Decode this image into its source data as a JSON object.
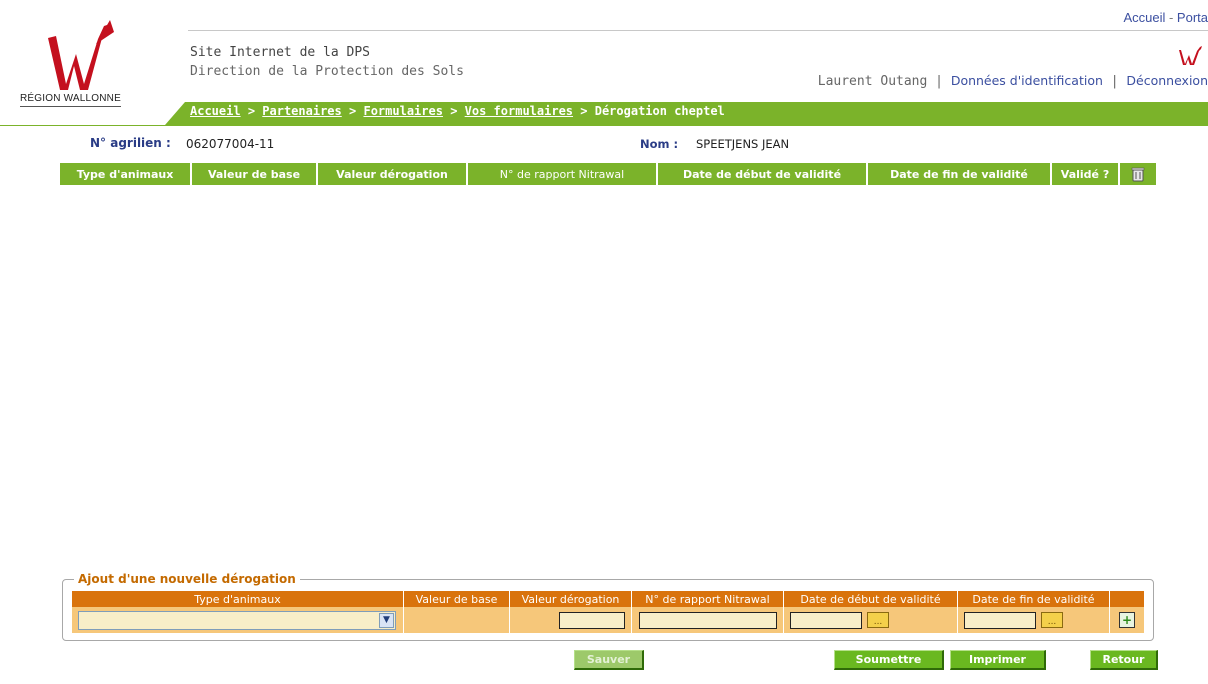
{
  "header": {
    "region_label": "RÉGION WALLONNE",
    "site_title": "Site Internet de la DPS",
    "site_subtitle": "Direction de la Protection des Sols",
    "top_links": {
      "home": "Accueil",
      "separator": " - ",
      "portal": "Porta"
    },
    "user_name": "Laurent Outang",
    "user_links": {
      "identification": "Données d'identification",
      "logout": "Déconnexion"
    },
    "brand_color": "#7bb32a",
    "accent_color": "#d9730c"
  },
  "breadcrumb": {
    "items": [
      "Accueil",
      "Partenaires",
      "Formulaires",
      "Vos formulaires"
    ],
    "separator": ">",
    "current": "Dérogation cheptel"
  },
  "info": {
    "agrilien_label": "N° agrilien :",
    "agrilien_value": "062077004-11",
    "nom_label": "Nom :",
    "nom_value": "SPEETJENS JEAN"
  },
  "main_table": {
    "columns": [
      "Type d'animaux",
      "Valeur de base",
      "Valeur dérogation",
      "N° de rapport Nitrawal",
      "Date de début de validité",
      "Date de fin de validité",
      "Validé ?"
    ],
    "trash_icon": "trash-icon",
    "rows": []
  },
  "add_form": {
    "legend": "Ajout d'une nouvelle dérogation",
    "columns": [
      "Type d'animaux",
      "Valeur de base",
      "Valeur dérogation",
      "N° de rapport Nitrawal",
      "Date de début de validité",
      "Date de fin de validité"
    ],
    "type_value": "",
    "calendar_glyph": "...",
    "add_icon": "plus-icon"
  },
  "buttons": {
    "save": "Sauver",
    "submit": "Soumettre",
    "print": "Imprimer",
    "back": "Retour"
  }
}
